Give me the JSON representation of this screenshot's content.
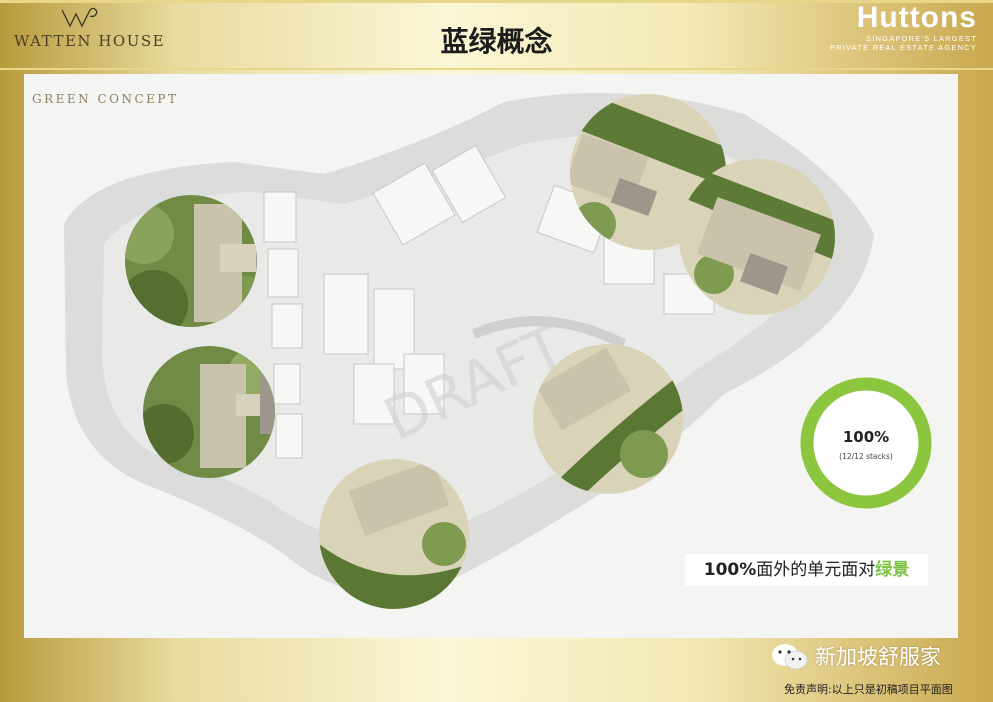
{
  "header": {
    "logo_text": "WATTEN HOUSE",
    "title": "蓝绿概念",
    "brand_name": "Huttons",
    "brand_tag_line1": "SINGAPORE'S LARGEST",
    "brand_tag_line2": "PRIVATE REAL ESTATE AGENCY"
  },
  "panel": {
    "concept_label": "GREEN CONCEPT",
    "watermark": "DRAFT",
    "ring_percent": "100%",
    "ring_sub": "(12/12 stacks)",
    "ring_fraction": 1.0,
    "callout_bold": "100%",
    "callout_text": "面外的单元面对",
    "callout_green": "绿景"
  },
  "footer": {
    "wechat_text": "新加坡舒服家",
    "disclaimer": "免责声明:以上只是初稿项目平面图"
  },
  "colors": {
    "ring_green": "#8cc63f",
    "callout_green": "#7cc243",
    "gold": "#c9a84e",
    "panel_bg": "#f4f4f3"
  },
  "icons": [
    "wechat-icon",
    "watten-house-logo-mark"
  ]
}
